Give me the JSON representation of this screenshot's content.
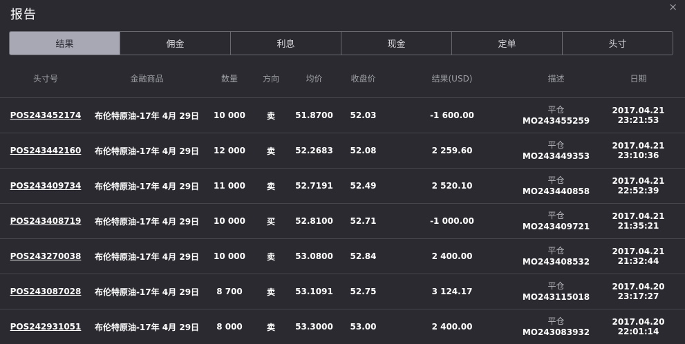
{
  "title": "报告",
  "close_icon": "×",
  "tabs": [
    "结果",
    "佣金",
    "利息",
    "现金",
    "定单",
    "头寸"
  ],
  "columns": [
    "头寸号",
    "金融商品",
    "数量",
    "方向",
    "均价",
    "收盘价",
    "结果(USD)",
    "描述",
    "日期"
  ],
  "rows": [
    {
      "pos": "POS243452174",
      "instrument": "布伦特原油-17年 4月 29日",
      "qty": "10 000",
      "dir": "卖",
      "avg": "51.8700",
      "close": "52.03",
      "result": "-1 600.00",
      "desc1": "平仓",
      "desc2": "MO243455259",
      "date": "2017.04.21 23:21:53"
    },
    {
      "pos": "POS243442160",
      "instrument": "布伦特原油-17年 4月 29日",
      "qty": "12 000",
      "dir": "卖",
      "avg": "52.2683",
      "close": "52.08",
      "result": "2 259.60",
      "desc1": "平仓",
      "desc2": "MO243449353",
      "date": "2017.04.21 23:10:36"
    },
    {
      "pos": "POS243409734",
      "instrument": "布伦特原油-17年 4月 29日",
      "qty": "11 000",
      "dir": "卖",
      "avg": "52.7191",
      "close": "52.49",
      "result": "2 520.10",
      "desc1": "平仓",
      "desc2": "MO243440858",
      "date": "2017.04.21 22:52:39"
    },
    {
      "pos": "POS243408719",
      "instrument": "布伦特原油-17年 4月 29日",
      "qty": "10 000",
      "dir": "买",
      "avg": "52.8100",
      "close": "52.71",
      "result": "-1 000.00",
      "desc1": "平仓",
      "desc2": "MO243409721",
      "date": "2017.04.21 21:35:21"
    },
    {
      "pos": "POS243270038",
      "instrument": "布伦特原油-17年 4月 29日",
      "qty": "10 000",
      "dir": "卖",
      "avg": "53.0800",
      "close": "52.84",
      "result": "2 400.00",
      "desc1": "平仓",
      "desc2": "MO243408532",
      "date": "2017.04.21 21:32:44"
    },
    {
      "pos": "POS243087028",
      "instrument": "布伦特原油-17年 4月 29日",
      "qty": "8 700",
      "dir": "卖",
      "avg": "53.1091",
      "close": "52.75",
      "result": "3 124.17",
      "desc1": "平仓",
      "desc2": "MO243115018",
      "date": "2017.04.20 23:17:27"
    },
    {
      "pos": "POS242931051",
      "instrument": "布伦特原油-17年 4月 29日",
      "qty": "8 000",
      "dir": "卖",
      "avg": "53.3000",
      "close": "53.00",
      "result": "2 400.00",
      "desc1": "平仓",
      "desc2": "MO243083932",
      "date": "2017.04.20 22:01:14"
    }
  ]
}
